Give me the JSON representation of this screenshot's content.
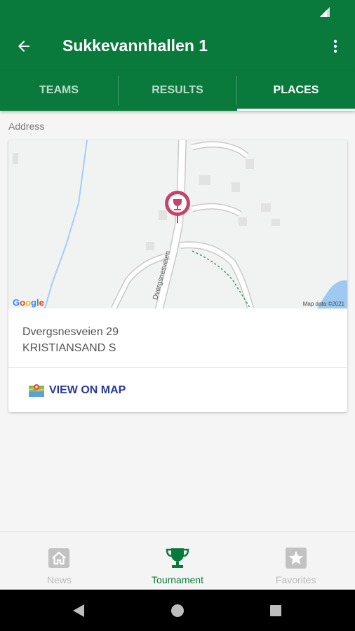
{
  "app": {
    "title": "Sukkevannhallen 1",
    "accent_color": "#0a7a3c"
  },
  "tabs": [
    {
      "label": "TEAMS",
      "active": false
    },
    {
      "label": "RESULTS",
      "active": false
    },
    {
      "label": "PLACES",
      "active": true
    }
  ],
  "place": {
    "section_label": "Address",
    "street": "Dvergsnesveien 29",
    "city": "KRISTIANSAND S",
    "view_on_map_label": "VIEW ON MAP",
    "map": {
      "road_label": "Dvergsnesveien",
      "google_logo": "Google",
      "attribution": "Map data ©2021",
      "pin_icon": "trophy-pin-icon"
    }
  },
  "bottom_nav": [
    {
      "label": "News",
      "icon": "home-icon",
      "active": false
    },
    {
      "label": "Tournament",
      "icon": "trophy-icon",
      "active": true
    },
    {
      "label": "Favorites",
      "icon": "star-icon",
      "active": false
    }
  ],
  "icons": {
    "back": "arrow-back-icon",
    "more": "more-vert-icon",
    "signal": "signal-icon"
  }
}
